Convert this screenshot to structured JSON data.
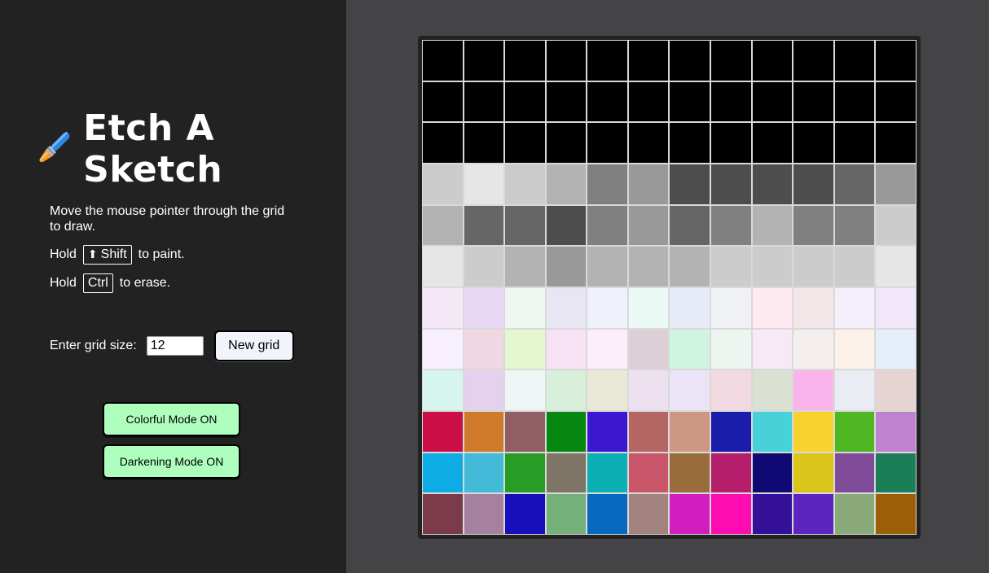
{
  "header": {
    "title": "Etch A Sketch",
    "icon": "paintbrush-icon"
  },
  "instructions": {
    "line1": "Move the mouse pointer through the grid to draw.",
    "hold1": "Hold",
    "shift_key": "Shift",
    "shift_icon": "⬆",
    "paint_text": "to paint.",
    "hold2": "Hold",
    "ctrl_key": "Ctrl",
    "erase_text": "to erase."
  },
  "grid_controls": {
    "label": "Enter grid size:",
    "value": "12",
    "new_grid_label": "New grid"
  },
  "modes": {
    "colorful_label": "Colorful Mode ON",
    "darkening_label": "Darkening Mode ON",
    "button_color": "#aeffbe"
  },
  "grid": {
    "size": 12,
    "cells": [
      [
        "#000000",
        "#000000",
        "#000000",
        "#000000",
        "#000000",
        "#000000",
        "#000000",
        "#000000",
        "#000000",
        "#000000",
        "#000000",
        "#000000"
      ],
      [
        "#000000",
        "#000000",
        "#000000",
        "#000000",
        "#000000",
        "#000000",
        "#000000",
        "#000000",
        "#000000",
        "#000000",
        "#000000",
        "#000000"
      ],
      [
        "#000000",
        "#000000",
        "#000000",
        "#000000",
        "#000000",
        "#000000",
        "#000000",
        "#000000",
        "#000000",
        "#000000",
        "#000000",
        "#000000"
      ],
      [
        "#cccccc",
        "#e6e6e6",
        "#cccccc",
        "#b3b3b3",
        "#808080",
        "#999999",
        "#4d4d4d",
        "#4d4d4d",
        "#4d4d4d",
        "#4d4d4d",
        "#666666",
        "#999999"
      ],
      [
        "#b3b3b3",
        "#666666",
        "#666666",
        "#4d4d4d",
        "#808080",
        "#999999",
        "#666666",
        "#808080",
        "#b3b3b3",
        "#808080",
        "#808080",
        "#cccccc"
      ],
      [
        "#e6e6e6",
        "#cccccc",
        "#b3b3b3",
        "#999999",
        "#b3b3b3",
        "#b3b3b3",
        "#b3b3b3",
        "#cccccc",
        "#cccccc",
        "#cccccc",
        "#cccccc",
        "#e6e6e6"
      ],
      [
        "#f5e8f6",
        "#e8d8f5",
        "#eff7f3",
        "#e8e6f2",
        "#eff2fb",
        "#ebf9f5",
        "#e6ebf7",
        "#f0f1f5",
        "#fde9ef",
        "#f2e6e8",
        "#f4effa",
        "#f0e8f9"
      ],
      [
        "#f7effd",
        "#efd8e2",
        "#e5f7d0",
        "#f7e2f3",
        "#fbedf9",
        "#dccfd6",
        "#d0f4e1",
        "#edf5f0",
        "#f7eaf7",
        "#f4eeef",
        "#fcf1e9",
        "#e6eef9"
      ],
      [
        "#d6f5ee",
        "#e5d0ee",
        "#eff5f5",
        "#d8f0db",
        "#e8ead7",
        "#ede1f0",
        "#ebe3f6",
        "#f2d8e0",
        "#dae0d2",
        "#f9b4ec",
        "#eaecf3",
        "#e6d4d2"
      ],
      [
        "#cc0e46",
        "#d07b2c",
        "#915e66",
        "#068810",
        "#3b18d0",
        "#b46662",
        "#ce9784",
        "#1a1da9",
        "#46d2d8",
        "#f8d32f",
        "#4fb722",
        "#bf82cf"
      ],
      [
        "#0dace5",
        "#44bad9",
        "#279d25",
        "#7e7566",
        "#0bb0b4",
        "#ca566a",
        "#9a6b3b",
        "#b41e6a",
        "#0f0a73",
        "#dbc51b",
        "#804c9a",
        "#1b7e58"
      ],
      [
        "#7b3b4b",
        "#a5819f",
        "#180fbc",
        "#73b07a",
        "#076ac0",
        "#a2837d",
        "#d11ebf",
        "#fd0db1",
        "#340f98",
        "#5d25c0",
        "#8aaa7a",
        "#9b6006"
      ]
    ]
  }
}
